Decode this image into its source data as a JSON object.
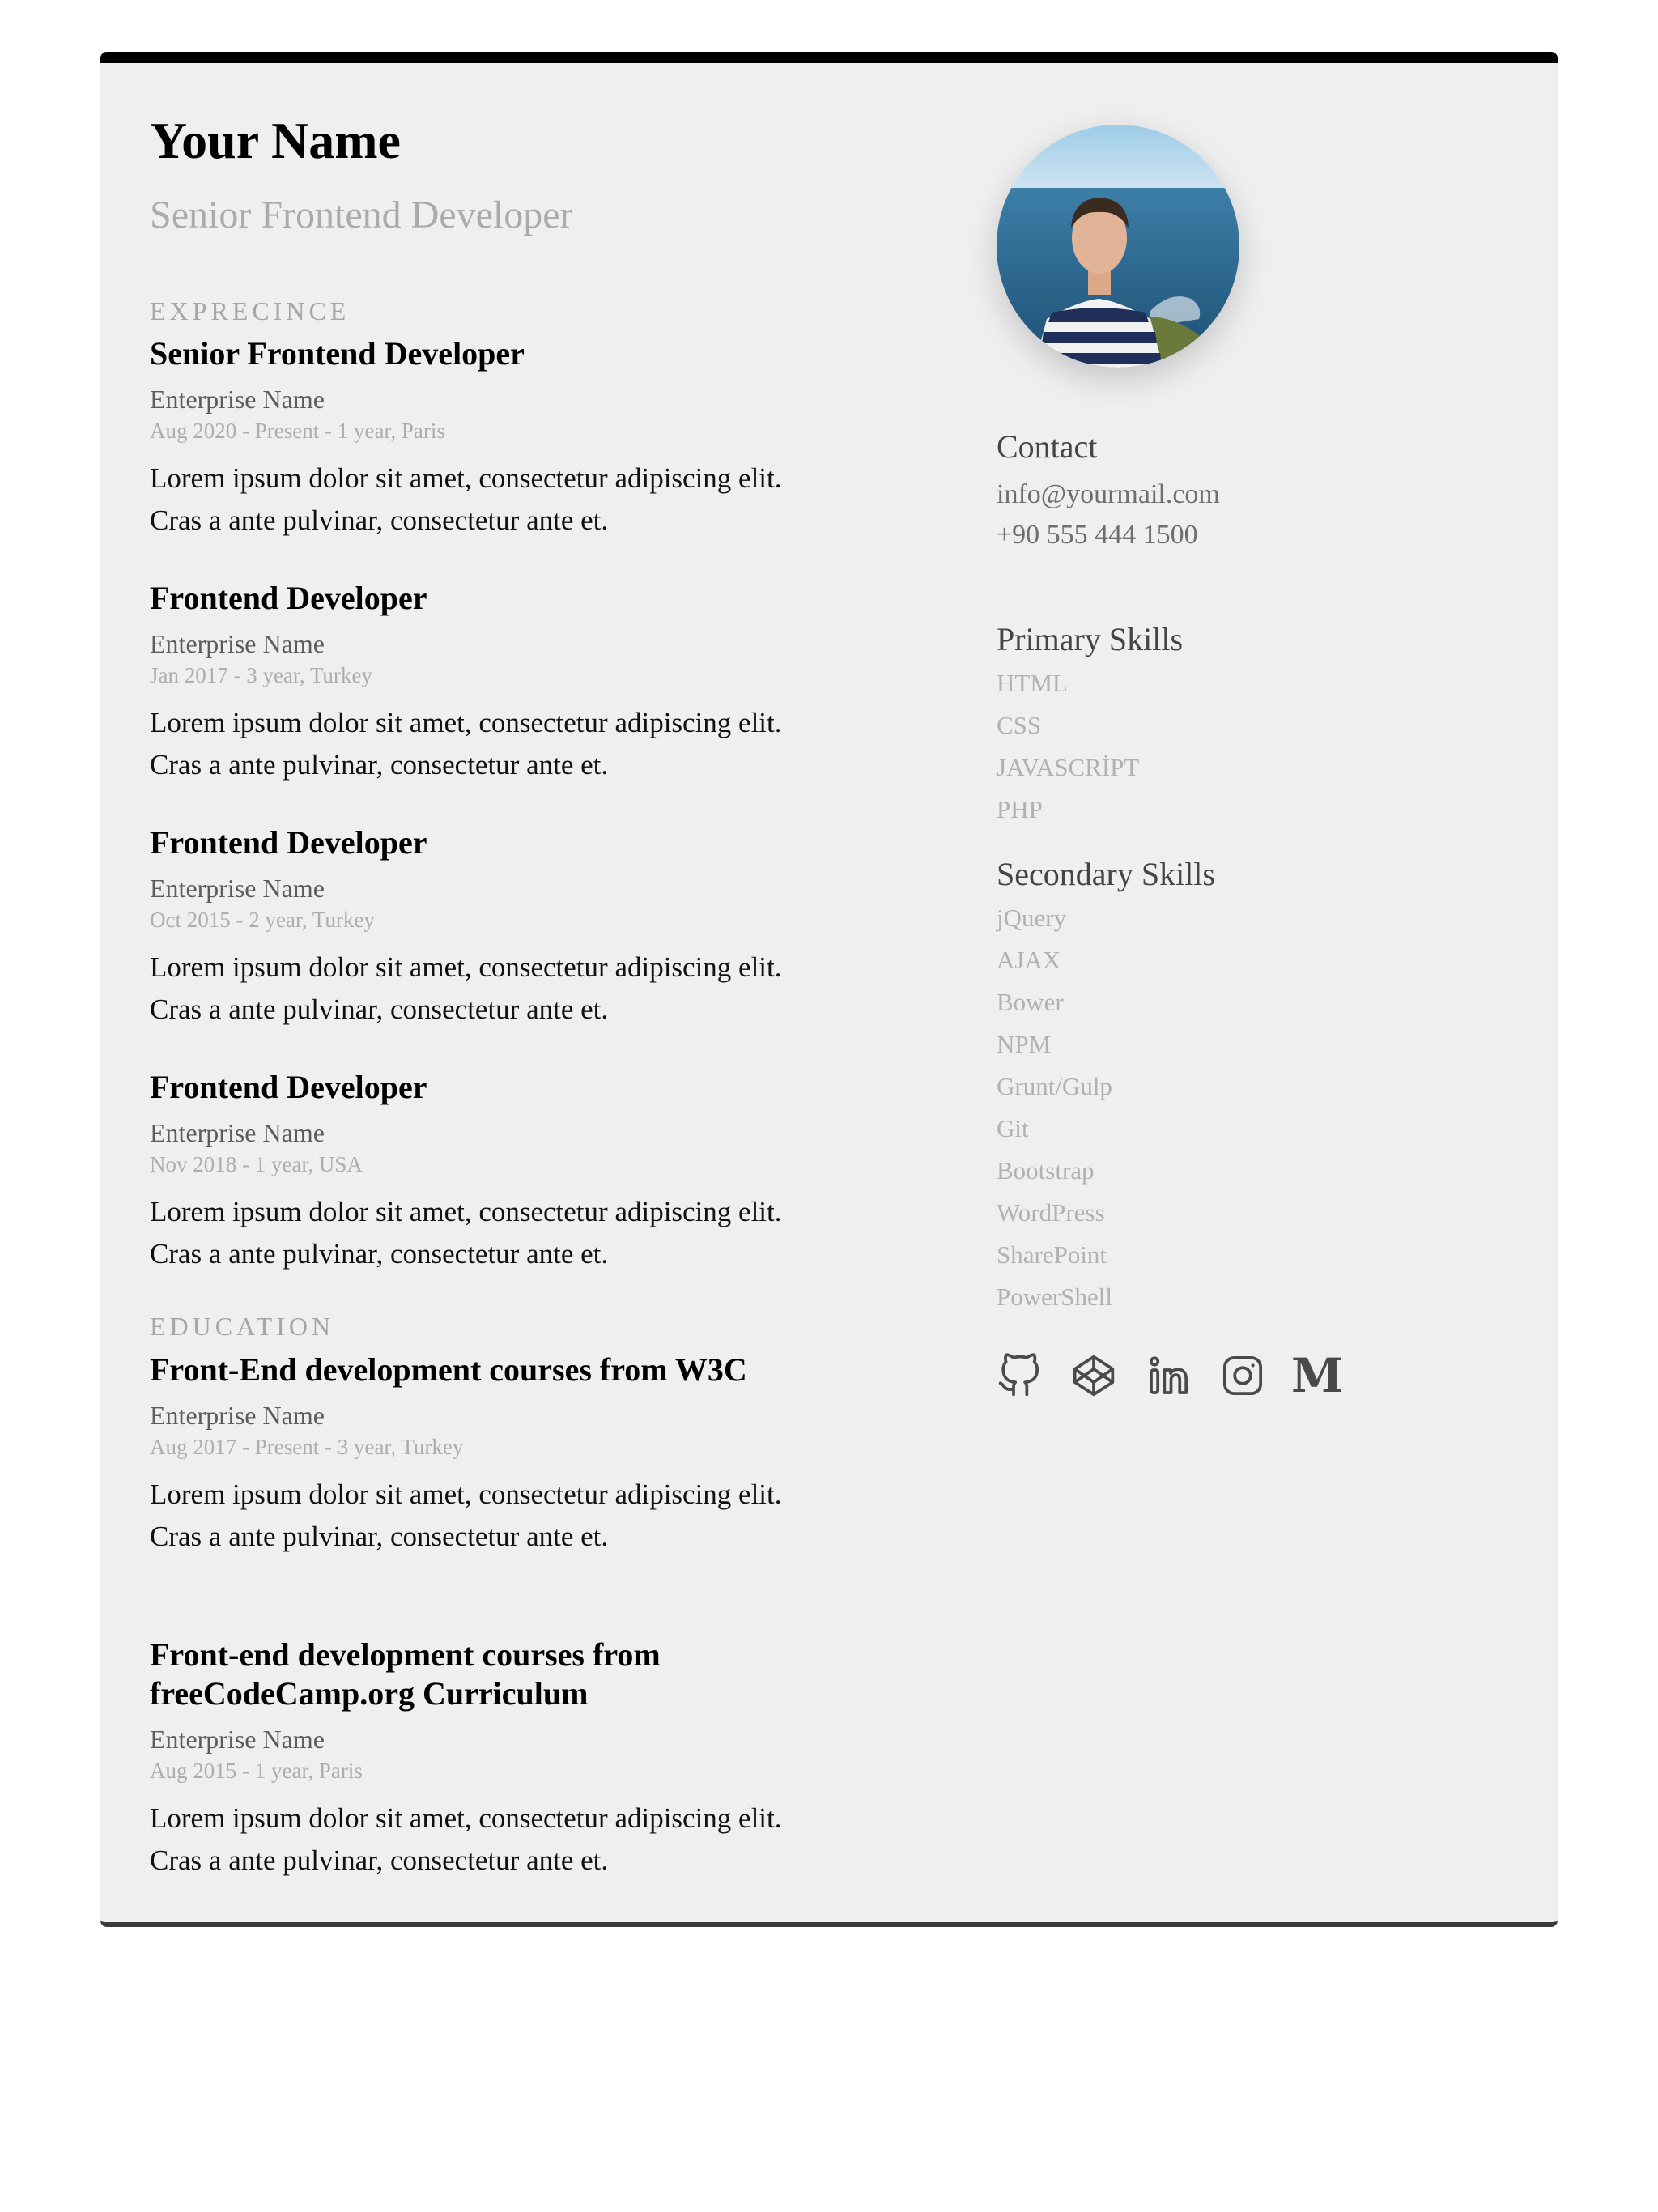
{
  "header": {
    "name": "Your Name",
    "title": "Senior Frontend Developer"
  },
  "experience": {
    "label": "EXPRECINCE",
    "items": [
      {
        "role": "Senior Frontend Developer",
        "company": "Enterprise Name",
        "period": "Aug 2020 - Present - 1 year, Paris",
        "desc1": "Lorem ipsum dolor sit amet, consectetur adipiscing elit.",
        "desc2": "Cras a ante pulvinar, consectetur ante et."
      },
      {
        "role": "Frontend Developer",
        "company": "Enterprise Name",
        "period": "Jan 2017 - 3 year, Turkey",
        "desc1": "Lorem ipsum dolor sit amet, consectetur adipiscing elit.",
        "desc2": "Cras a ante pulvinar, consectetur ante et."
      },
      {
        "role": "Frontend Developer",
        "company": "Enterprise Name",
        "period": "Oct 2015 - 2 year, Turkey",
        "desc1": "Lorem ipsum dolor sit amet, consectetur adipiscing elit.",
        "desc2": "Cras a ante pulvinar, consectetur ante et."
      },
      {
        "role": "Frontend Developer",
        "company": "Enterprise Name",
        "period": "Nov 2018 - 1 year, USA",
        "desc1": "Lorem ipsum dolor sit amet, consectetur adipiscing elit.",
        "desc2": "Cras a ante pulvinar, consectetur ante et."
      }
    ]
  },
  "education": {
    "label": "EDUCATION",
    "items": [
      {
        "course": "Front-End development courses from W3C",
        "school": "Enterprise Name",
        "period": "Aug 2017 - Present - 3 year, Turkey",
        "desc1": "Lorem ipsum dolor sit amet, consectetur adipiscing elit.",
        "desc2": "Cras a ante pulvinar, consectetur ante et."
      },
      {
        "course_line1": "Front-end development courses from",
        "course_line2": "freeCodeCamp.org Curriculum",
        "school": "Enterprise Name",
        "period": "Aug 2015 - 1 year, Paris",
        "desc1": "Lorem ipsum dolor sit amet, consectetur adipiscing elit.",
        "desc2": "Cras a ante pulvinar, consectetur ante et."
      }
    ]
  },
  "contact": {
    "heading": "Contact",
    "email": "info@yourmail.com",
    "phone": "+90 555 444 1500"
  },
  "primary_skills": {
    "heading": "Primary Skills",
    "items": [
      "HTML",
      "CSS",
      "JAVASCRİPT",
      "PHP"
    ]
  },
  "secondary_skills": {
    "heading": "Secondary Skills",
    "items": [
      "jQuery",
      "AJAX",
      "Bower",
      "NPM",
      "Grunt/Gulp",
      "Git",
      "Bootstrap",
      "WordPress",
      "SharePoint",
      "PowerShell"
    ]
  },
  "socials": {
    "icons": [
      "github-icon",
      "codepen-icon",
      "linkedin-icon",
      "instagram-icon",
      "medium-icon"
    ],
    "medium_glyph": "M"
  },
  "colors": {
    "card_background": "#efefef",
    "top_border": "#000000",
    "muted_text": "#ababab"
  }
}
